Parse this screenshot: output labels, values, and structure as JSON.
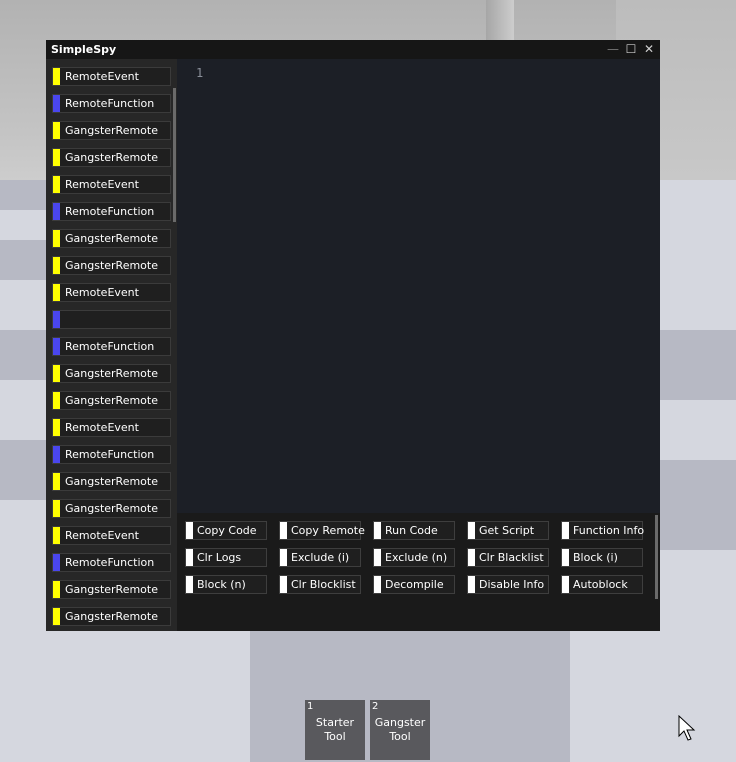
{
  "window": {
    "title": "SimpleSpy",
    "controls": {
      "minimize": "—",
      "maximize": "☐",
      "close": "✕"
    }
  },
  "colors": {
    "event": "#ffff00",
    "function": "#4a46ee",
    "button_swatch": "#ffffff"
  },
  "remotes": [
    {
      "label": "RemoteEvent",
      "kind": "event"
    },
    {
      "label": "RemoteFunction",
      "kind": "function"
    },
    {
      "label": "GangsterRemote",
      "kind": "event"
    },
    {
      "label": "GangsterRemote",
      "kind": "event"
    },
    {
      "label": "RemoteEvent",
      "kind": "event"
    },
    {
      "label": "RemoteFunction",
      "kind": "function"
    },
    {
      "label": "GangsterRemote",
      "kind": "event"
    },
    {
      "label": "GangsterRemote",
      "kind": "event"
    },
    {
      "label": "RemoteEvent",
      "kind": "event"
    },
    {
      "label": "",
      "kind": "function"
    },
    {
      "label": "RemoteFunction",
      "kind": "function"
    },
    {
      "label": "GangsterRemote",
      "kind": "event"
    },
    {
      "label": "GangsterRemote",
      "kind": "event"
    },
    {
      "label": "RemoteEvent",
      "kind": "event"
    },
    {
      "label": "RemoteFunction",
      "kind": "function"
    },
    {
      "label": "GangsterRemote",
      "kind": "event"
    },
    {
      "label": "GangsterRemote",
      "kind": "event"
    },
    {
      "label": "RemoteEvent",
      "kind": "event"
    },
    {
      "label": "RemoteFunction",
      "kind": "function"
    },
    {
      "label": "GangsterRemote",
      "kind": "event"
    },
    {
      "label": "GangsterRemote",
      "kind": "event"
    }
  ],
  "editor": {
    "line_numbers": [
      "1"
    ]
  },
  "buttons": [
    [
      "Copy Code",
      "Copy Remote",
      "Run Code",
      "Get Script",
      "Function Info"
    ],
    [
      "Clr Logs",
      "Exclude (i)",
      "Exclude (n)",
      "Clr Blacklist",
      "Block (i)"
    ],
    [
      "Block (n)",
      "Clr Blocklist",
      "Decompile",
      "Disable Info",
      "Autoblock"
    ]
  ],
  "hotbar": [
    {
      "slot": "1",
      "name": "Starter Tool"
    },
    {
      "slot": "2",
      "name": "Gangster Tool"
    }
  ]
}
